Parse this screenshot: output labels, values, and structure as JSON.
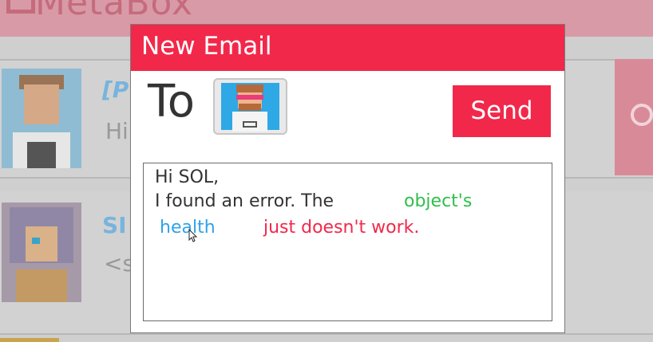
{
  "background": {
    "header_title": "MetaBox",
    "row1": {
      "sender": "[P",
      "preview": "Hi",
      "meta": ".)"
    },
    "row2": {
      "sender": "SI",
      "preview": "<s"
    }
  },
  "modal": {
    "title": "New Email",
    "to_label": "To",
    "send_label": "Send",
    "message": {
      "greeting": "Hi SOL,",
      "body_text": "I found an error. The",
      "token_object": "object's",
      "token_property": "health",
      "token_issue": "just doesn't work."
    }
  },
  "colors": {
    "accent": "#f2284a",
    "token_object": "#2fbf4a",
    "token_property": "#2fa2ea",
    "token_issue": "#f2284a"
  },
  "icons": {
    "recipient": "recipient-avatar",
    "cursor": "mouse-cursor-icon"
  }
}
